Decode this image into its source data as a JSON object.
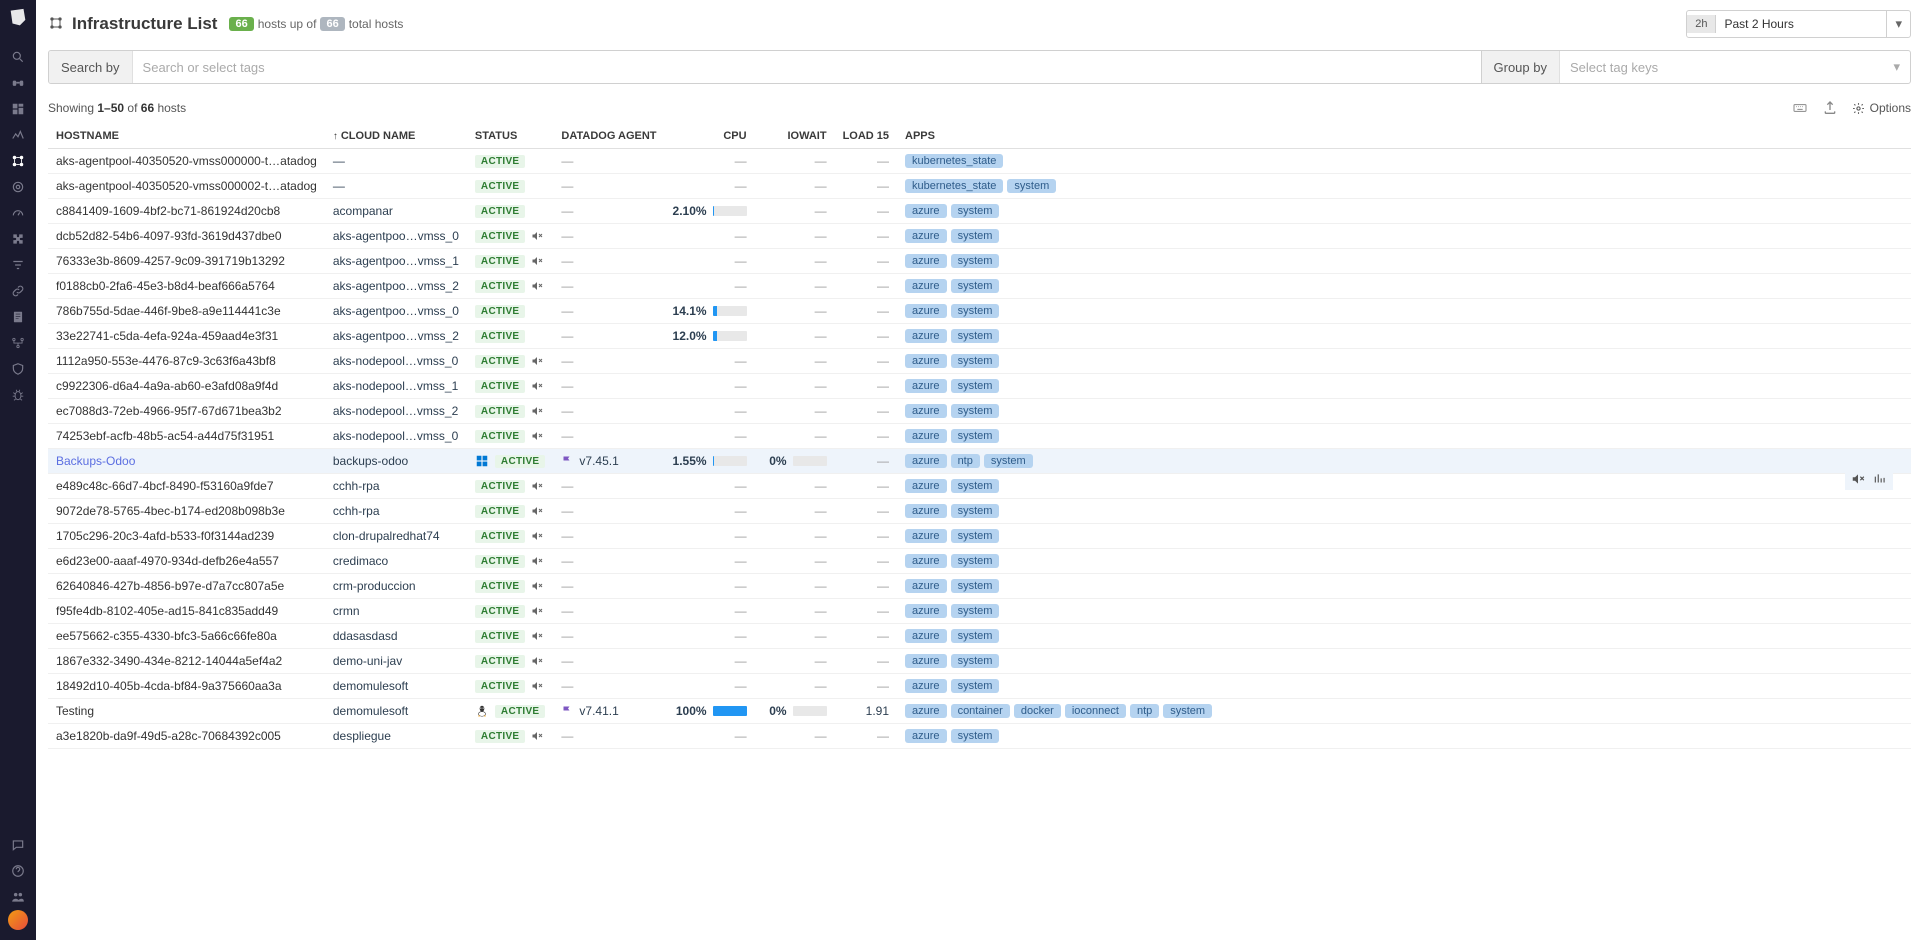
{
  "header": {
    "title": "Infrastructure List",
    "hosts_up_badge": "66",
    "hosts_up_text": "hosts up of",
    "hosts_total_badge": "66",
    "hosts_total_text": "total hosts",
    "time_badge": "2h",
    "time_text": "Past 2 Hours"
  },
  "filter": {
    "search_label": "Search by",
    "search_placeholder": "Search or select tags",
    "group_label": "Group by",
    "group_placeholder": "Select tag keys"
  },
  "results": {
    "prefix": "Showing ",
    "range": "1–50",
    "of": " of ",
    "total": "66",
    "suffix": " hosts",
    "options_label": "Options"
  },
  "columns": {
    "hostname": "HOSTNAME",
    "cloud": "CLOUD NAME",
    "status": "STATUS",
    "agent": "DATADOG AGENT",
    "cpu": "CPU",
    "iowait": "IOWAIT",
    "load": "LOAD 15",
    "apps": "APPS"
  },
  "rows": [
    {
      "hostname": "aks-agentpool-40350520-vmss000000-t…atadog",
      "cloud": "—",
      "status": "ACTIVE",
      "muted": false,
      "os": null,
      "agent": "—",
      "cpu": null,
      "iowait": null,
      "load": null,
      "apps": [
        "kubernetes_state"
      ]
    },
    {
      "hostname": "aks-agentpool-40350520-vmss000002-t…atadog",
      "cloud": "—",
      "status": "ACTIVE",
      "muted": false,
      "os": null,
      "agent": "—",
      "cpu": null,
      "iowait": null,
      "load": null,
      "apps": [
        "kubernetes_state",
        "system"
      ]
    },
    {
      "hostname": "c8841409-1609-4bf2-bc71-861924d20cb8",
      "cloud": "acompanar",
      "status": "ACTIVE",
      "muted": false,
      "os": null,
      "agent": "—",
      "cpu": 2.1,
      "iowait": null,
      "load": null,
      "apps": [
        "azure",
        "system"
      ]
    },
    {
      "hostname": "dcb52d82-54b6-4097-93fd-3619d437dbe0",
      "cloud": "aks-agentpoo…vmss_0",
      "status": "ACTIVE",
      "muted": true,
      "os": null,
      "agent": "—",
      "cpu": null,
      "iowait": null,
      "load": null,
      "apps": [
        "azure",
        "system"
      ]
    },
    {
      "hostname": "76333e3b-8609-4257-9c09-391719b13292",
      "cloud": "aks-agentpoo…vmss_1",
      "status": "ACTIVE",
      "muted": true,
      "os": null,
      "agent": "—",
      "cpu": null,
      "iowait": null,
      "load": null,
      "apps": [
        "azure",
        "system"
      ]
    },
    {
      "hostname": "f0188cb0-2fa6-45e3-b8d4-beaf666a5764",
      "cloud": "aks-agentpoo…vmss_2",
      "status": "ACTIVE",
      "muted": true,
      "os": null,
      "agent": "—",
      "cpu": null,
      "iowait": null,
      "load": null,
      "apps": [
        "azure",
        "system"
      ]
    },
    {
      "hostname": "786b755d-5dae-446f-9be8-a9e114441c3e",
      "cloud": "aks-agentpoo…vmss_0",
      "status": "ACTIVE",
      "muted": false,
      "os": null,
      "agent": "—",
      "cpu": 14.1,
      "iowait": null,
      "load": null,
      "apps": [
        "azure",
        "system"
      ]
    },
    {
      "hostname": "33e22741-c5da-4efa-924a-459aad4e3f31",
      "cloud": "aks-agentpoo…vmss_2",
      "status": "ACTIVE",
      "muted": false,
      "os": null,
      "agent": "—",
      "cpu": 12.0,
      "iowait": null,
      "load": null,
      "apps": [
        "azure",
        "system"
      ]
    },
    {
      "hostname": "1112a950-553e-4476-87c9-3c63f6a43bf8",
      "cloud": "aks-nodepool…vmss_0",
      "status": "ACTIVE",
      "muted": true,
      "os": null,
      "agent": "—",
      "cpu": null,
      "iowait": null,
      "load": null,
      "apps": [
        "azure",
        "system"
      ]
    },
    {
      "hostname": "c9922306-d6a4-4a9a-ab60-e3afd08a9f4d",
      "cloud": "aks-nodepool…vmss_1",
      "status": "ACTIVE",
      "muted": true,
      "os": null,
      "agent": "—",
      "cpu": null,
      "iowait": null,
      "load": null,
      "apps": [
        "azure",
        "system"
      ]
    },
    {
      "hostname": "ec7088d3-72eb-4966-95f7-67d671bea3b2",
      "cloud": "aks-nodepool…vmss_2",
      "status": "ACTIVE",
      "muted": true,
      "os": null,
      "agent": "—",
      "cpu": null,
      "iowait": null,
      "load": null,
      "apps": [
        "azure",
        "system"
      ]
    },
    {
      "hostname": "74253ebf-acfb-48b5-ac54-a44d75f31951",
      "cloud": "aks-nodepool…vmss_0",
      "status": "ACTIVE",
      "muted": true,
      "os": null,
      "agent": "—",
      "cpu": null,
      "iowait": null,
      "load": null,
      "apps": [
        "azure",
        "system"
      ]
    },
    {
      "hostname": "Backups-Odoo",
      "cloud": "backups-odoo",
      "status": "ACTIVE",
      "muted": false,
      "os": "windows",
      "agent": "v7.45.1",
      "cpu": 1.55,
      "iowait": 0,
      "load": null,
      "apps": [
        "azure",
        "ntp",
        "system"
      ],
      "hovered": true
    },
    {
      "hostname": "e489c48c-66d7-4bcf-8490-f53160a9fde7",
      "cloud": "cchh-rpa",
      "status": "ACTIVE",
      "muted": true,
      "os": null,
      "agent": "—",
      "cpu": null,
      "iowait": null,
      "load": null,
      "apps": [
        "azure",
        "system"
      ]
    },
    {
      "hostname": "9072de78-5765-4bec-b174-ed208b098b3e",
      "cloud": "cchh-rpa",
      "status": "ACTIVE",
      "muted": true,
      "os": null,
      "agent": "—",
      "cpu": null,
      "iowait": null,
      "load": null,
      "apps": [
        "azure",
        "system"
      ]
    },
    {
      "hostname": "1705c296-20c3-4afd-b533-f0f3144ad239",
      "cloud": "clon-drupalredhat74",
      "status": "ACTIVE",
      "muted": true,
      "os": null,
      "agent": "—",
      "cpu": null,
      "iowait": null,
      "load": null,
      "apps": [
        "azure",
        "system"
      ]
    },
    {
      "hostname": "e6d23e00-aaaf-4970-934d-defb26e4a557",
      "cloud": "credimaco",
      "status": "ACTIVE",
      "muted": true,
      "os": null,
      "agent": "—",
      "cpu": null,
      "iowait": null,
      "load": null,
      "apps": [
        "azure",
        "system"
      ]
    },
    {
      "hostname": "62640846-427b-4856-b97e-d7a7cc807a5e",
      "cloud": "crm-produccion",
      "status": "ACTIVE",
      "muted": true,
      "os": null,
      "agent": "—",
      "cpu": null,
      "iowait": null,
      "load": null,
      "apps": [
        "azure",
        "system"
      ]
    },
    {
      "hostname": "f95fe4db-8102-405e-ad15-841c835add49",
      "cloud": "crmn",
      "status": "ACTIVE",
      "muted": true,
      "os": null,
      "agent": "—",
      "cpu": null,
      "iowait": null,
      "load": null,
      "apps": [
        "azure",
        "system"
      ]
    },
    {
      "hostname": "ee575662-c355-4330-bfc3-5a66c66fe80a",
      "cloud": "ddasasdasd",
      "status": "ACTIVE",
      "muted": true,
      "os": null,
      "agent": "—",
      "cpu": null,
      "iowait": null,
      "load": null,
      "apps": [
        "azure",
        "system"
      ]
    },
    {
      "hostname": "1867e332-3490-434e-8212-14044a5ef4a2",
      "cloud": "demo-uni-jav",
      "status": "ACTIVE",
      "muted": true,
      "os": null,
      "agent": "—",
      "cpu": null,
      "iowait": null,
      "load": null,
      "apps": [
        "azure",
        "system"
      ]
    },
    {
      "hostname": "18492d10-405b-4cda-bf84-9a375660aa3a",
      "cloud": "demomulesoft",
      "status": "ACTIVE",
      "muted": true,
      "os": null,
      "agent": "—",
      "cpu": null,
      "iowait": null,
      "load": null,
      "apps": [
        "azure",
        "system"
      ]
    },
    {
      "hostname": "Testing",
      "cloud": "demomulesoft",
      "status": "ACTIVE",
      "muted": false,
      "os": "linux",
      "agent": "v7.41.1",
      "cpu": 100,
      "iowait": 0,
      "load": 1.91,
      "apps": [
        "azure",
        "container",
        "docker",
        "ioconnect",
        "ntp",
        "system"
      ]
    },
    {
      "hostname": "a3e1820b-da9f-49d5-a28c-70684392c005",
      "cloud": "despliegue",
      "status": "ACTIVE",
      "muted": true,
      "os": null,
      "agent": "—",
      "cpu": null,
      "iowait": null,
      "load": null,
      "apps": [
        "azure",
        "system"
      ]
    }
  ]
}
